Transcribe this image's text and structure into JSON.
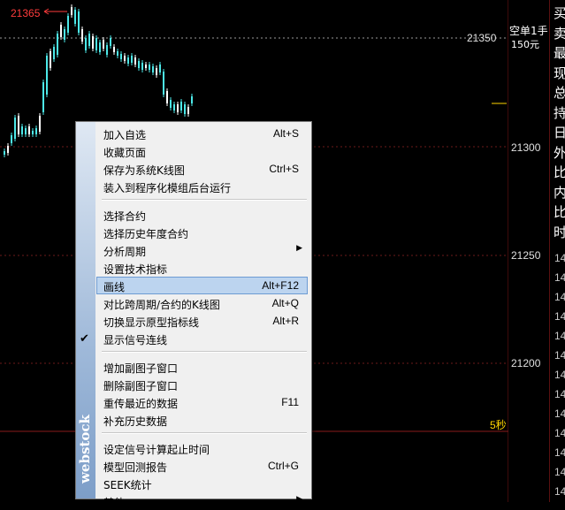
{
  "chart": {
    "peak_label": "21365",
    "order_label": "空单1手",
    "order_price": "150元",
    "timer": "5秒",
    "price_levels": [
      "21350",
      "21300",
      "21250",
      "21200"
    ],
    "colors": {
      "up": "#4ce8e8",
      "down": "#ffffff",
      "grid": "#6b1a1a",
      "label": "#ff3c3c"
    }
  },
  "right_panel": {
    "chars": [
      "买",
      "卖",
      "最",
      "现",
      "总",
      "持",
      "日",
      "外",
      "比",
      "内",
      "比",
      "时"
    ],
    "times": [
      "14",
      "14",
      "14",
      "14",
      "14",
      "14",
      "14",
      "14",
      "14",
      "14",
      "14",
      "14",
      "14"
    ]
  },
  "context_menu": {
    "logo_text": "webstock",
    "groups": [
      [
        {
          "label": "加入自选",
          "shortcut": "Alt+S"
        },
        {
          "label": "收藏页面",
          "shortcut": ""
        },
        {
          "label": "保存为系统K线图",
          "shortcut": "Ctrl+S"
        },
        {
          "label": "装入到程序化模组后台运行",
          "shortcut": ""
        }
      ],
      [
        {
          "label": "选择合约",
          "shortcut": ""
        },
        {
          "label": "选择历史年度合约",
          "shortcut": ""
        },
        {
          "label": "分析周期",
          "shortcut": "",
          "submenu": true
        },
        {
          "label": "设置技术指标",
          "shortcut": ""
        },
        {
          "label": "画线",
          "shortcut": "Alt+F12",
          "highlighted": true
        },
        {
          "label": "对比跨周期/合约的K线图",
          "shortcut": "Alt+Q"
        },
        {
          "label": "切换显示原型指标线",
          "shortcut": "Alt+R"
        },
        {
          "label": "显示信号连线",
          "shortcut": "",
          "checked": true
        }
      ],
      [
        {
          "label": "增加副图子窗口",
          "shortcut": ""
        },
        {
          "label": "删除副图子窗口",
          "shortcut": ""
        },
        {
          "label": "重传最近的数据",
          "shortcut": "F11"
        },
        {
          "label": "补充历史数据",
          "shortcut": ""
        }
      ],
      [
        {
          "label": "设定信号计算起止时间",
          "shortcut": ""
        },
        {
          "label": "模型回测报告",
          "shortcut": "Ctrl+G"
        },
        {
          "label": "SEEK统计",
          "shortcut": ""
        },
        {
          "label": "其他",
          "shortcut": "",
          "submenu": true
        }
      ]
    ]
  }
}
